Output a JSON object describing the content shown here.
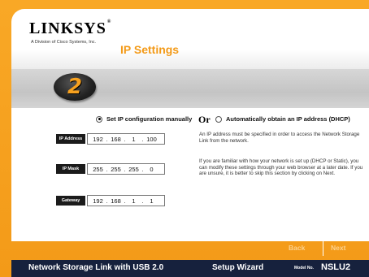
{
  "brand": {
    "logo": "LINKSYS",
    "registered": "®",
    "subtitle": "A Division of Cisco Systems, Inc."
  },
  "page": {
    "title": "IP Settings",
    "step": "2"
  },
  "options": {
    "manual_label": "Set IP configuration manually",
    "manual_selected": true,
    "or_label": "Or",
    "dhcp_label": "Automatically obtain an IP address (DHCP)",
    "dhcp_selected": false
  },
  "fields": {
    "ip_address": {
      "label": "IP Address",
      "octets": [
        "192",
        "168",
        "1",
        "100"
      ]
    },
    "ip_mask": {
      "label": "IP Mask",
      "octets": [
        "255",
        "255",
        "255",
        "0"
      ]
    },
    "gateway": {
      "label": "Gateway",
      "octets": [
        "192",
        "168",
        "1",
        "1"
      ]
    }
  },
  "description": {
    "para1": "An IP address must be specified in order to access the Network Storage Link from the network.",
    "para2": "If you are familiar with how your network is set up (DHCP or Static), you can modify these settings through your web browser at a later date.  If you are unsure, it is better to skip this section by clicking on Next."
  },
  "nav": {
    "back_label": "Back",
    "next_label": "Next"
  },
  "footer": {
    "product": "Network Storage Link with USB 2.0",
    "wizard": "Setup Wizard",
    "model_label": "Model No.",
    "model": "NSLU2"
  },
  "colors": {
    "accent": "#f39a18",
    "footer_bg": "#16213d"
  }
}
